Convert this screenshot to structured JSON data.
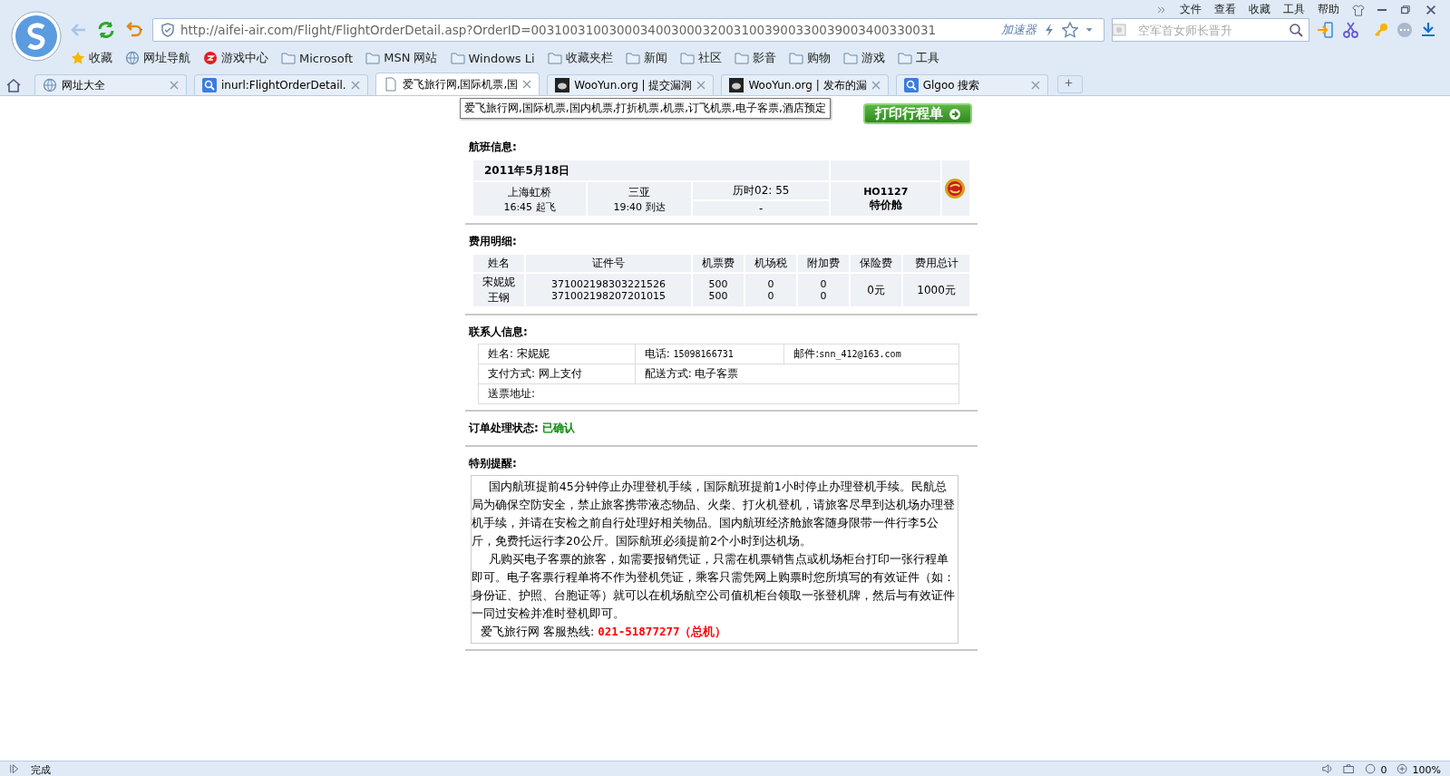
{
  "browser": {
    "menu": [
      "文件",
      "查看",
      "收藏",
      "工具",
      "帮助"
    ],
    "url": "http://aifei-air.com/Flight/FlightOrderDetail.asp?OrderID=0031003100300034003000320031003900330039003400330031",
    "accelerator": "加速器",
    "search": {
      "placeholder": "空军首女师长晋升"
    },
    "bookmarks": [
      {
        "label": "收藏",
        "kind": "star"
      },
      {
        "label": "网址导航",
        "kind": "globe"
      },
      {
        "label": "游戏中心",
        "kind": "game"
      },
      {
        "label": "Microsoft",
        "kind": "folder"
      },
      {
        "label": "MSN 网站",
        "kind": "folder"
      },
      {
        "label": "Windows Li",
        "kind": "folder"
      },
      {
        "label": "收藏夹栏",
        "kind": "folder"
      },
      {
        "label": "新闻",
        "kind": "folder"
      },
      {
        "label": "社区",
        "kind": "folder"
      },
      {
        "label": "影音",
        "kind": "folder"
      },
      {
        "label": "购物",
        "kind": "folder"
      },
      {
        "label": "游戏",
        "kind": "folder"
      },
      {
        "label": "工具",
        "kind": "folder"
      }
    ],
    "tabs": [
      {
        "title": "网址大全",
        "kind": "globe",
        "selected": false
      },
      {
        "title": "inurl:FlightOrderDetail.",
        "kind": "search",
        "selected": false
      },
      {
        "title": "爱飞旅行网,国际机票,国",
        "kind": "page",
        "selected": true
      },
      {
        "title": "WooYun.org | 提交漏洞",
        "kind": "site",
        "selected": false
      },
      {
        "title": "WooYun.org | 发布的漏",
        "kind": "site",
        "selected": false
      },
      {
        "title": "Glgoo 搜索",
        "kind": "search",
        "selected": false
      }
    ],
    "tooltip": "爱飞旅行网,国际机票,国内机票,打折机票,机票,订飞机票,电子客票,酒店预定",
    "status": "完成",
    "counter": "0",
    "zoom": "100%"
  },
  "order": {
    "print_button": "打印行程单",
    "flight": {
      "title": "航班信息:",
      "date": "2011年5月18日",
      "from": "上海虹桥",
      "departure": "16:45 起飞",
      "to": "三亚",
      "arrival": "19:40 到达",
      "duration": "历时02: 55",
      "stop": "-",
      "number": "HO1127",
      "cabin": "特价舱"
    },
    "fees": {
      "title": "费用明细:",
      "columns": [
        "姓名",
        "证件号",
        "机票费",
        "机场税",
        "附加费",
        "保险费",
        "费用总计"
      ],
      "rows": [
        {
          "name": "宋妮妮",
          "id": "371002198303221526",
          "fare": "500",
          "tax": "0",
          "surcharge": "0"
        },
        {
          "name": "王钢",
          "id": "371002198207201015",
          "fare": "500",
          "tax": "0",
          "surcharge": "0"
        }
      ],
      "insurance": "0元",
      "total": "1000元"
    },
    "contact": {
      "title": "联系人信息:",
      "name": "姓名: 宋妮妮",
      "phone_label": "电话:",
      "phone": "15098166731",
      "email_label": "邮件:",
      "email": "snn_412@163.com",
      "payment": "支付方式: 网上支付",
      "delivery": "配送方式: 电子客票",
      "address": "送票地址:"
    },
    "status": {
      "label": "订单处理状态:",
      "value": "已确认"
    },
    "notice": {
      "title": "特别提醒:",
      "paragraphs": [
        "国内航班提前45分钟停止办理登机手续，国际航班提前1小时停止办理登机手续。民航总局为确保空防安全，禁止旅客携带液态物品、火柴、打火机登机，请旅客尽早到达机场办理登机手续，并请在安检之前自行处理好相关物品。国内航班经济舱旅客随身限带一件行李5公斤，免费托运行李20公斤。国际航班必须提前2个小时到达机场。",
        "凡购买电子客票的旅客，如需要报销凭证，只需在机票销售点或机场柜台打印一张行程单即可。电子客票行程单将不作为登机凭证，乘客只需凭网上购票时您所填写的有效证件（如：身份证、护照、台胞证等）就可以在机场航空公司值机柜台领取一张登机牌，然后与有效证件一同过安检并准时登机即可。"
      ],
      "hotline_label": "爱飞旅行网 客服热线:",
      "hotline": "021-51877277（总机）"
    }
  }
}
